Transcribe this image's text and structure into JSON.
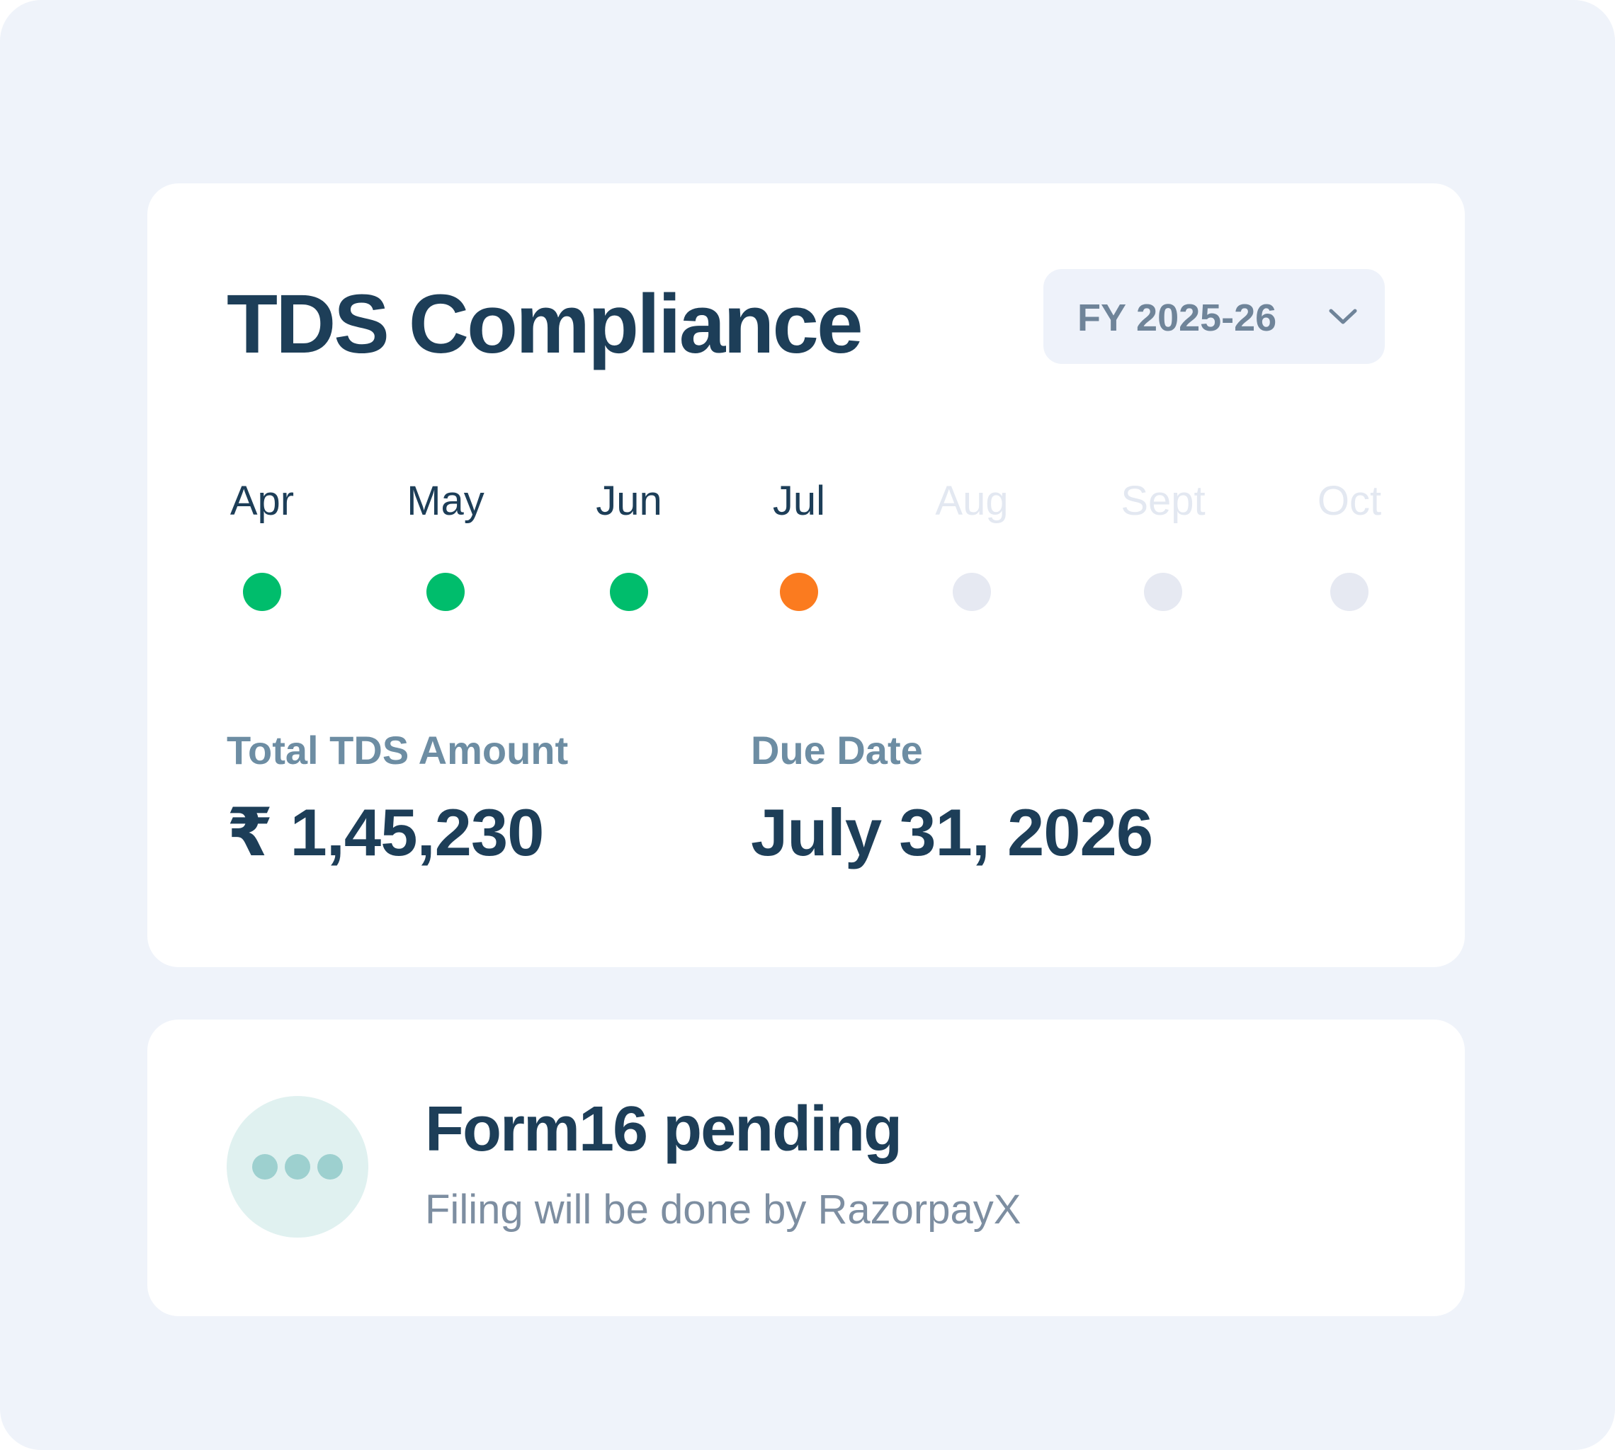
{
  "compliance": {
    "title": "TDS Compliance",
    "fy_select": {
      "value": "FY 2025-26",
      "icon": "chevron-down-icon"
    },
    "months": [
      {
        "label": "Apr",
        "status": "filed",
        "label_color": "#1d3e58",
        "dot_color": "#00bd6c"
      },
      {
        "label": "May",
        "status": "filed",
        "label_color": "#1d3e58",
        "dot_color": "#00bd6c"
      },
      {
        "label": "Jun",
        "status": "filed",
        "label_color": "#1d3e58",
        "dot_color": "#00bd6c"
      },
      {
        "label": "Jul",
        "status": "current",
        "label_color": "#1d3e58",
        "dot_color": "#fb7b1f"
      },
      {
        "label": "Aug",
        "status": "upcoming",
        "label_color": "#e3e8f1",
        "dot_color": "#e6e9f2"
      },
      {
        "label": "Sept",
        "status": "upcoming",
        "label_color": "#e3e8f1",
        "dot_color": "#e6e9f2"
      },
      {
        "label": "Oct",
        "status": "upcoming",
        "label_color": "#e3e8f1",
        "dot_color": "#e6e9f2"
      }
    ],
    "total": {
      "label": "Total TDS Amount",
      "value": "₹ 1,45,230"
    },
    "due": {
      "label": "Due Date",
      "value": "July 31, 2026"
    }
  },
  "form16": {
    "icon": "more-dots-icon",
    "title": "Form16 pending",
    "subtitle": "Filing will be done by RazorpayX"
  }
}
